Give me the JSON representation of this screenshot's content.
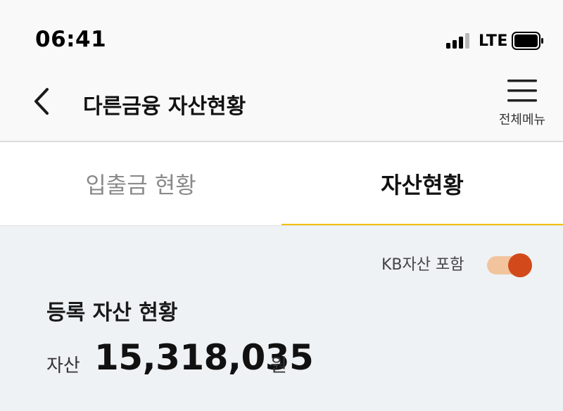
{
  "status_bar": {
    "time": "06:41",
    "network": "LTE"
  },
  "header": {
    "title": "다른금융 자산현황",
    "menu_label": "전체메뉴"
  },
  "tabs": [
    {
      "label": "입출금 현황",
      "active": false
    },
    {
      "label": "자산현황",
      "active": true
    }
  ],
  "toggle": {
    "label": "KB자산 포함",
    "on": true
  },
  "summary": {
    "title": "등록 자산 현황",
    "asset_label": "자산",
    "asset_value": "15,318,035",
    "currency_unit": "원"
  },
  "colors": {
    "accent_yellow": "#f2c200",
    "toggle_on": "#d24a1c",
    "toggle_track": "#f2c49e",
    "content_bg": "#eff2f5"
  },
  "icons": {
    "back": "chevron-left-icon",
    "menu": "hamburger-icon",
    "signal": "signal-bars-icon",
    "battery": "battery-icon"
  }
}
